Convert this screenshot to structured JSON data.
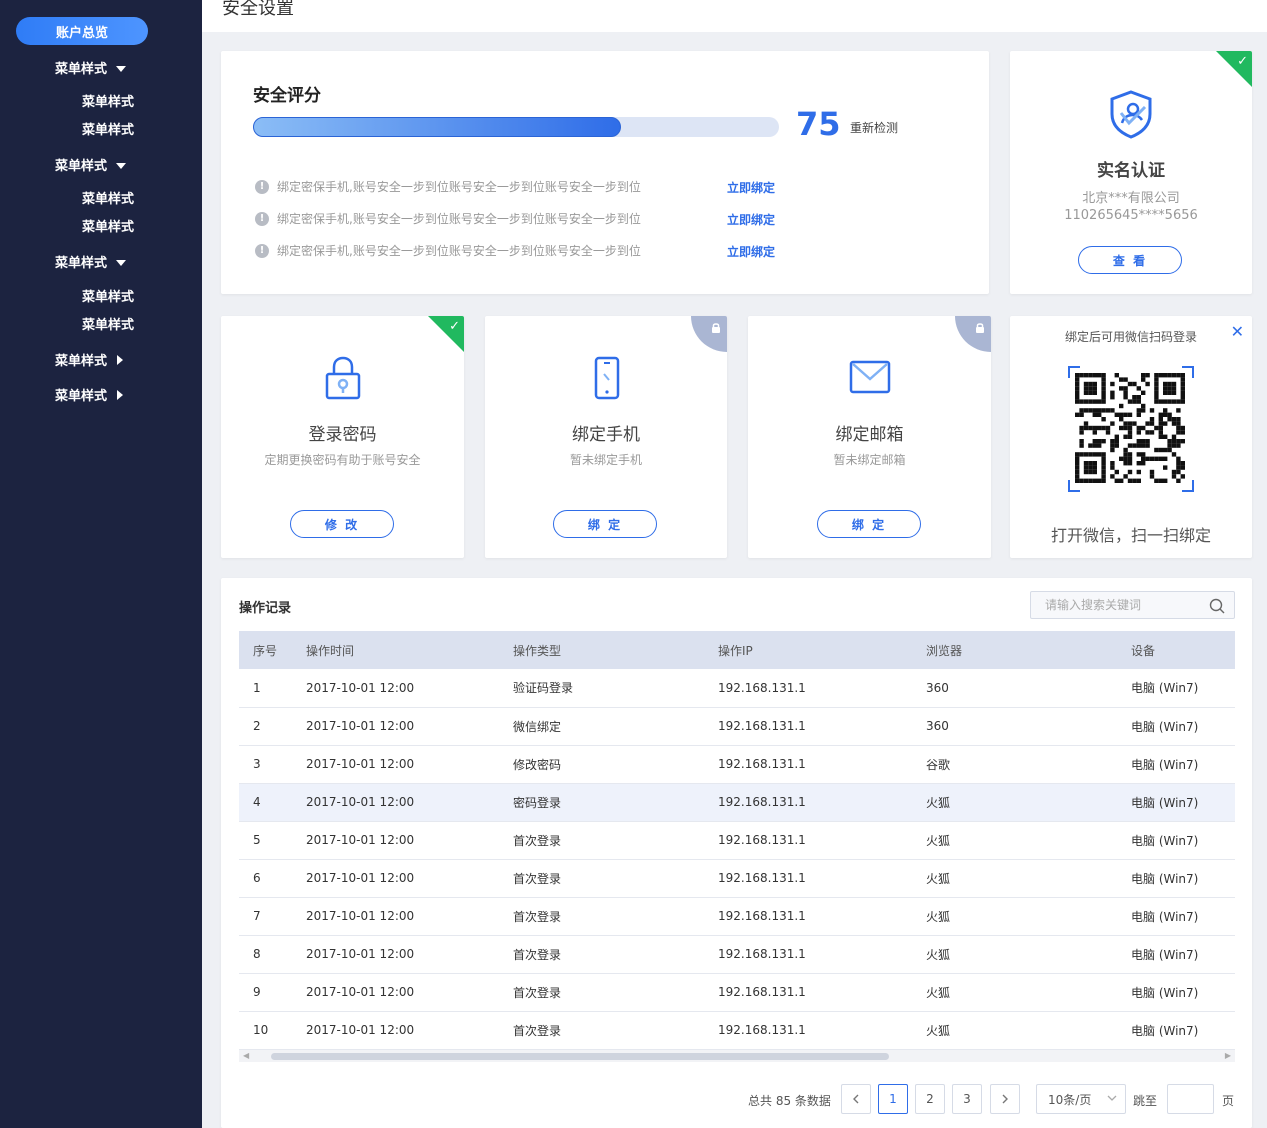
{
  "sidebar": {
    "active": "账户总览",
    "groups": [
      {
        "label": "菜单样式",
        "subs": [
          "菜单样式",
          "菜单样式"
        ]
      },
      {
        "label": "菜单样式",
        "subs": [
          "菜单样式",
          "菜单样式"
        ]
      },
      {
        "label": "菜单样式",
        "subs": [
          "菜单样式",
          "菜单样式"
        ]
      }
    ],
    "collapsed": [
      "菜单样式",
      "菜单样式"
    ]
  },
  "header": {
    "title": "安全设置"
  },
  "score": {
    "title": "安全评分",
    "value": "75",
    "progress": 0.7,
    "recheck": "重新检测",
    "tips": [
      {
        "text": "绑定密保手机,账号安全一步到位账号安全一步到位账号安全一步到位",
        "link": "立即绑定"
      },
      {
        "text": "绑定密保手机,账号安全一步到位账号安全一步到位账号安全一步到位",
        "link": "立即绑定"
      },
      {
        "text": "绑定密保手机,账号安全一步到位账号安全一步到位账号安全一步到位",
        "link": "立即绑定"
      }
    ]
  },
  "realname": {
    "title": "实名认证",
    "company": "北京***有限公司",
    "id": "110265645****5656",
    "button": "查 看"
  },
  "cards": [
    {
      "title": "登录密码",
      "sub": "定期更换密码有助于账号安全",
      "button": "修 改",
      "status": "verified",
      "icon": "lock-icon"
    },
    {
      "title": "绑定手机",
      "sub": "暂未绑定手机",
      "button": "绑 定",
      "status": "locked",
      "icon": "phone-icon"
    },
    {
      "title": "绑定邮箱",
      "sub": "暂未绑定邮箱",
      "button": "绑 定",
      "status": "locked",
      "icon": "mail-icon"
    }
  ],
  "qr": {
    "top": "绑定后可用微信扫码登录",
    "bottom": "打开微信，扫一扫绑定"
  },
  "records": {
    "title": "操作记录",
    "search_placeholder": "请输入搜索关键词",
    "columns": [
      "序号",
      "操作时间",
      "操作类型",
      "操作IP",
      "浏览器",
      "设备"
    ],
    "rows": [
      [
        "1",
        "2017-10-01 12:00",
        "验证码登录",
        "192.168.131.1",
        "360",
        "电脑 (Win7)"
      ],
      [
        "2",
        "2017-10-01 12:00",
        "微信绑定",
        "192.168.131.1",
        "360",
        "电脑 (Win7)"
      ],
      [
        "3",
        "2017-10-01 12:00",
        "修改密码",
        "192.168.131.1",
        "谷歌",
        "电脑 (Win7)"
      ],
      [
        "4",
        "2017-10-01 12:00",
        "密码登录",
        "192.168.131.1",
        "火狐",
        "电脑 (Win7)"
      ],
      [
        "5",
        "2017-10-01 12:00",
        "首次登录",
        "192.168.131.1",
        "火狐",
        "电脑 (Win7)"
      ],
      [
        "6",
        "2017-10-01 12:00",
        "首次登录",
        "192.168.131.1",
        "火狐",
        "电脑 (Win7)"
      ],
      [
        "7",
        "2017-10-01 12:00",
        "首次登录",
        "192.168.131.1",
        "火狐",
        "电脑 (Win7)"
      ],
      [
        "8",
        "2017-10-01 12:00",
        "首次登录",
        "192.168.131.1",
        "火狐",
        "电脑 (Win7)"
      ],
      [
        "9",
        "2017-10-01 12:00",
        "首次登录",
        "192.168.131.1",
        "火狐",
        "电脑 (Win7)"
      ],
      [
        "10",
        "2017-10-01 12:00",
        "首次登录",
        "192.168.131.1",
        "火狐",
        "电脑 (Win7)"
      ]
    ],
    "highlight_row": 3
  },
  "pagination": {
    "total": "总共 85 条数据",
    "pages": [
      "1",
      "2",
      "3"
    ],
    "current": "1",
    "page_size": "10条/页",
    "jump": "跳至",
    "unit": "页"
  },
  "colors": {
    "accent": "#2f6de8",
    "sidebar": "#1c2340",
    "success": "#21b95f"
  }
}
